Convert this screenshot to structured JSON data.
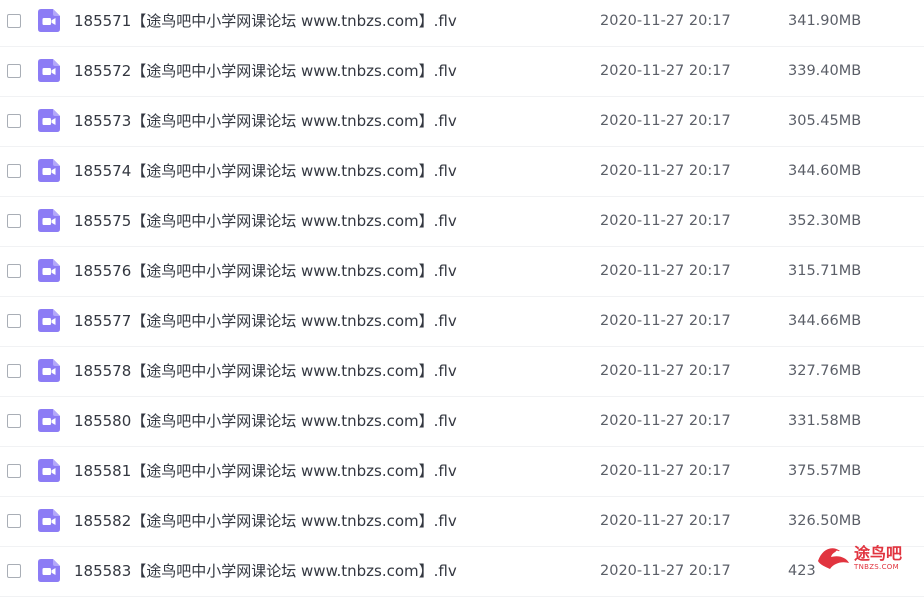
{
  "files": [
    {
      "name": "185571【途鸟吧中小学网课论坛 www.tnbzs.com】.flv",
      "date": "2020-11-27 20:17",
      "size": "341.90MB",
      "icon": "video-file-icon"
    },
    {
      "name": "185572【途鸟吧中小学网课论坛 www.tnbzs.com】.flv",
      "date": "2020-11-27 20:17",
      "size": "339.40MB",
      "icon": "video-file-icon"
    },
    {
      "name": "185573【途鸟吧中小学网课论坛 www.tnbzs.com】.flv",
      "date": "2020-11-27 20:17",
      "size": "305.45MB",
      "icon": "video-file-icon"
    },
    {
      "name": "185574【途鸟吧中小学网课论坛 www.tnbzs.com】.flv",
      "date": "2020-11-27 20:17",
      "size": "344.60MB",
      "icon": "video-file-icon"
    },
    {
      "name": "185575【途鸟吧中小学网课论坛 www.tnbzs.com】.flv",
      "date": "2020-11-27 20:17",
      "size": "352.30MB",
      "icon": "video-file-icon"
    },
    {
      "name": "185576【途鸟吧中小学网课论坛 www.tnbzs.com】.flv",
      "date": "2020-11-27 20:17",
      "size": "315.71MB",
      "icon": "video-file-icon"
    },
    {
      "name": "185577【途鸟吧中小学网课论坛 www.tnbzs.com】.flv",
      "date": "2020-11-27 20:17",
      "size": "344.66MB",
      "icon": "video-file-icon"
    },
    {
      "name": "185578【途鸟吧中小学网课论坛 www.tnbzs.com】.flv",
      "date": "2020-11-27 20:17",
      "size": "327.76MB",
      "icon": "video-file-icon"
    },
    {
      "name": "185580【途鸟吧中小学网课论坛 www.tnbzs.com】.flv",
      "date": "2020-11-27 20:17",
      "size": "331.58MB",
      "icon": "video-file-icon"
    },
    {
      "name": "185581【途鸟吧中小学网课论坛 www.tnbzs.com】.flv",
      "date": "2020-11-27 20:17",
      "size": "375.57MB",
      "icon": "video-file-icon"
    },
    {
      "name": "185582【途鸟吧中小学网课论坛 www.tnbzs.com】.flv",
      "date": "2020-11-27 20:17",
      "size": "326.50MB",
      "icon": "video-file-icon"
    },
    {
      "name": "185583【途鸟吧中小学网课论坛 www.tnbzs.com】.flv",
      "date": "2020-11-27 20:17",
      "size": "423",
      "icon": "video-file-icon"
    }
  ],
  "watermark": {
    "text": "途鸟吧",
    "subtext": "TNBZS.COM"
  },
  "colors": {
    "icon_bg": "#8c7cf5",
    "text_primary": "#333740",
    "text_secondary": "#5b5f68",
    "watermark": "#e1343f"
  }
}
